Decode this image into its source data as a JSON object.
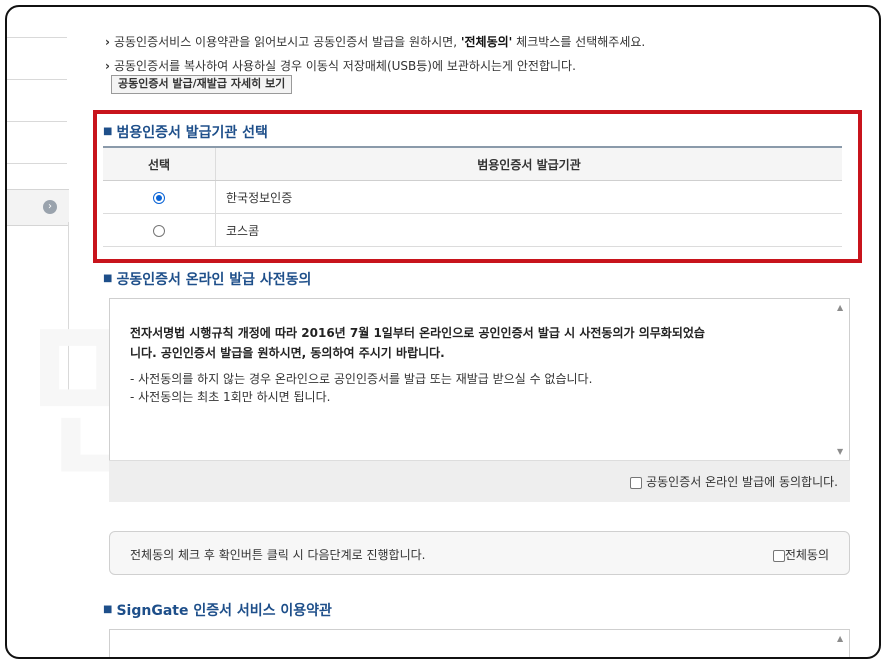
{
  "notices": [
    {
      "pre": "공동인증서비스 이용약관을 읽어보시고 공동인증서 발급을 원하시면, ",
      "bold": "'전체동의'",
      "post": " 체크박스를 선택해주세요."
    },
    {
      "pre": "공동인증서를 복사하여 사용하실 경우 이동식 저장매체(USB등)에 보관하시는게 안전합니다.",
      "bold": "",
      "post": ""
    }
  ],
  "detail_button": "공동인증서 발급/재발급 자세히 보기",
  "watermark": "먼저와 결국",
  "ca_section": {
    "title": "범용인증서 발급기관 선택",
    "col_select": "선택",
    "col_org": "범용인증서 발급기관",
    "rows": [
      {
        "org": "한국정보인증",
        "selected": true
      },
      {
        "org": "코스콤",
        "selected": false
      }
    ]
  },
  "consent_section": {
    "title": "공동인증서 온라인 발급 사전동의",
    "main_line1": "전자서명법 시행규칙 개정에 따라 2016년 7월 1일부터 온라인으로 공인인증서 발급 시 사전동의가 의무화되었습",
    "main_line2": "니다. 공인인증서 발급을 원하시면, 동의하여 주시기 바랍니다.",
    "bullet1": "- 사전동의를 하지 않는 경우 온라인으로 공인인증서를 발급 또는 재발급 받으실 수 없습니다.",
    "bullet2": "- 사전동의는 최초 1회만 하시면 됩니다.",
    "checkbox_label": "공동인증서 온라인 발급에 동의합니다.",
    "checked": false
  },
  "all_agree": {
    "message": "전체동의 체크 후 확인버튼 클릭 시 다음단계로 진행합니다.",
    "checkbox_label": "전체동의",
    "checked": false
  },
  "signgate_section": {
    "title": "SignGate 인증서 서비스 이용약관"
  },
  "colors": {
    "accent": "#1e4f8a",
    "highlight_border": "#c8141c",
    "radio_selected": "#0a64d6"
  }
}
